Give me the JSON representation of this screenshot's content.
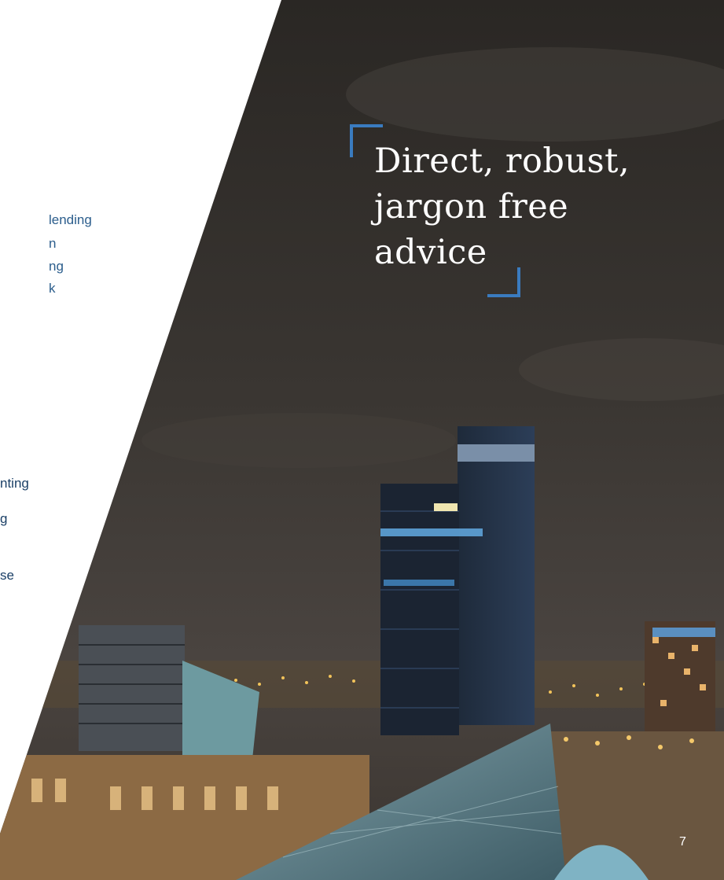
{
  "left_column": {
    "lines": [
      " lending",
      "n",
      "ng",
      "k",
      "nting",
      "g",
      "se"
    ]
  },
  "quote": {
    "lines": [
      "Direct, robust,",
      "jargon free",
      "advice"
    ]
  },
  "page_number": "7",
  "colors": {
    "accent": "#3a7bbf",
    "text_blue": "#1f4e79",
    "sky": "#2e2a27"
  }
}
